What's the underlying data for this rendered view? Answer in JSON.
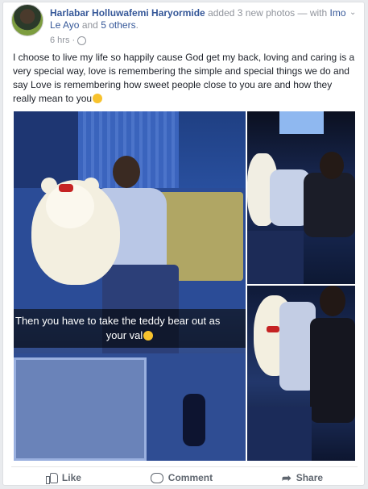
{
  "post": {
    "author": "Harlabar Holluwafemi Haryormide",
    "action": "added 3 new photos — with",
    "tag1": "Imo Le Ayo",
    "and": "and",
    "others": "5 others",
    "period": ".",
    "time": "6 hrs ·",
    "text": "I choose to live my life so happily cause God get my back, loving and caring is a very special way, love is remembering the simple and special things we do and say Love is remembering how sweet people close to you are and how they really mean to you"
  },
  "photos": {
    "caption_line1": "Then you have to take the teddy bear out as",
    "caption_line2": "your val"
  },
  "actions": {
    "like": "Like",
    "comment": "Comment",
    "share": "Share"
  },
  "icons": {
    "like": "thumbs-up-icon",
    "comment": "comment-icon",
    "share": "share-icon",
    "privacy": "globe-icon",
    "menu": "chevron-down-icon"
  },
  "colors": {
    "link": "#365899",
    "muted": "#90949c",
    "text": "#1d2129"
  }
}
